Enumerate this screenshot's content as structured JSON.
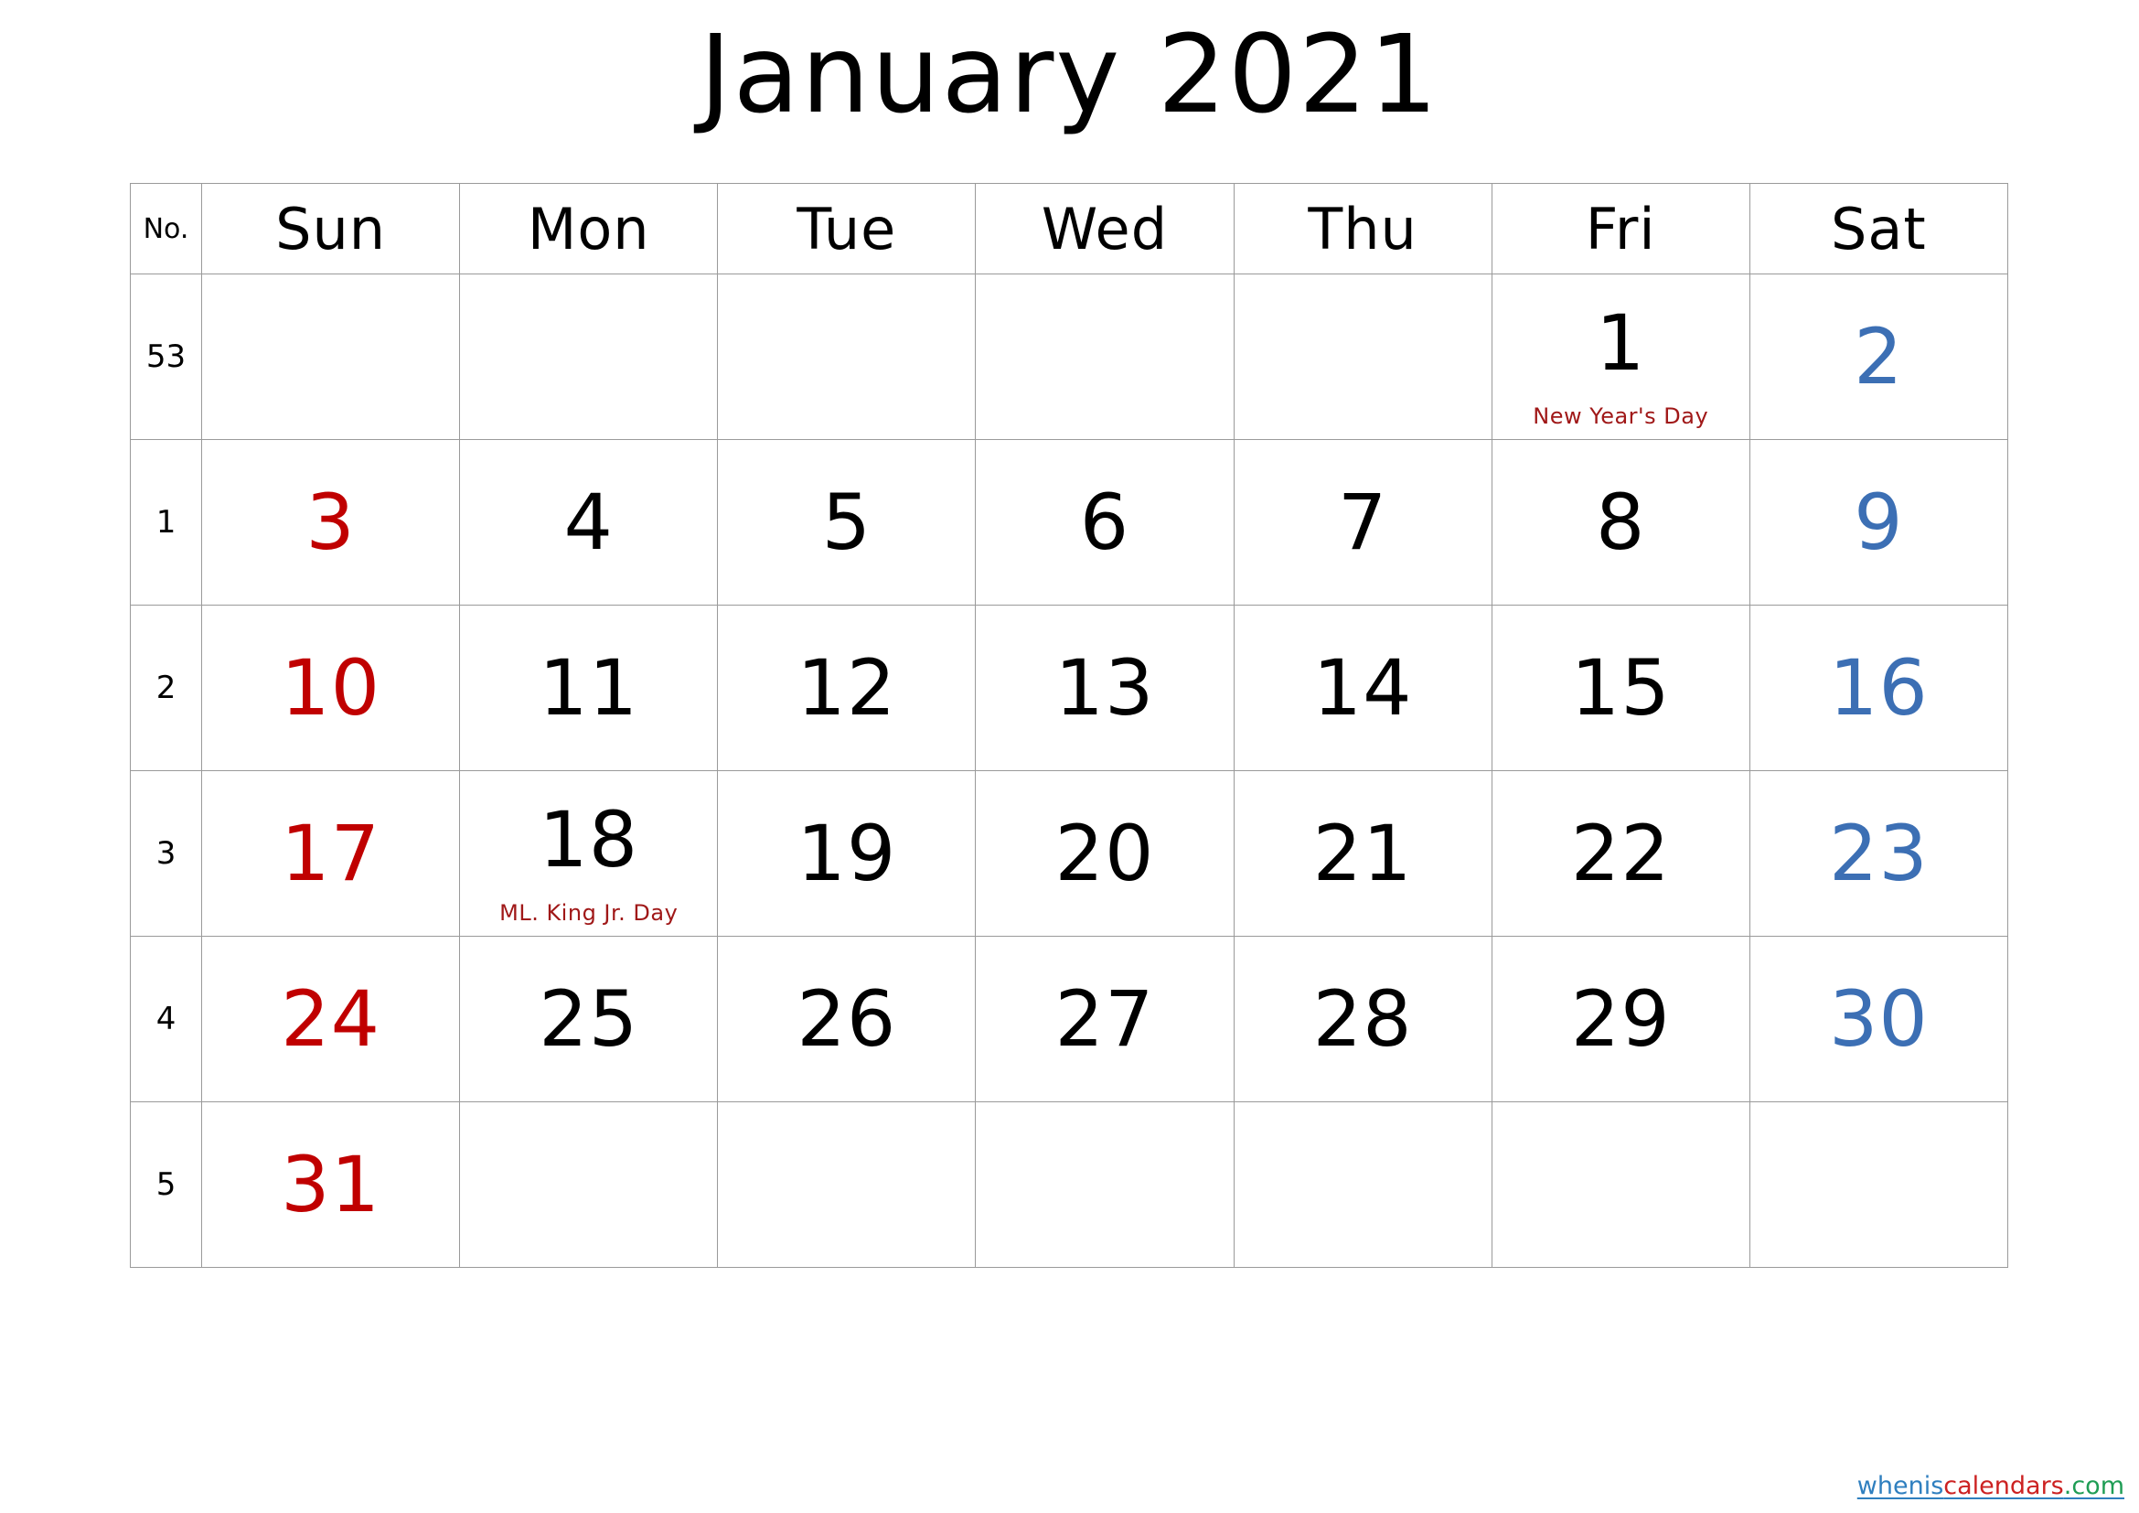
{
  "title": "January 2021",
  "colors": {
    "sunday": "#c00000",
    "saturday": "#3c6fb4",
    "weekday": "#000000",
    "holiday_note": "#a01818",
    "grid": "#9a9a9a",
    "watermark_blue": "#2f7fbf",
    "watermark_red": "#cc2222",
    "watermark_green": "#1f9d55"
  },
  "header": {
    "week_no_label": "No.",
    "days": [
      "Sun",
      "Mon",
      "Tue",
      "Wed",
      "Thu",
      "Fri",
      "Sat"
    ]
  },
  "weeks": [
    {
      "no": "53",
      "days": [
        {
          "date": "",
          "note": ""
        },
        {
          "date": "",
          "note": ""
        },
        {
          "date": "",
          "note": ""
        },
        {
          "date": "",
          "note": ""
        },
        {
          "date": "",
          "note": ""
        },
        {
          "date": "1",
          "note": "New Year's Day"
        },
        {
          "date": "2",
          "note": ""
        }
      ]
    },
    {
      "no": "1",
      "days": [
        {
          "date": "3",
          "note": ""
        },
        {
          "date": "4",
          "note": ""
        },
        {
          "date": "5",
          "note": ""
        },
        {
          "date": "6",
          "note": ""
        },
        {
          "date": "7",
          "note": ""
        },
        {
          "date": "8",
          "note": ""
        },
        {
          "date": "9",
          "note": ""
        }
      ]
    },
    {
      "no": "2",
      "days": [
        {
          "date": "10",
          "note": ""
        },
        {
          "date": "11",
          "note": ""
        },
        {
          "date": "12",
          "note": ""
        },
        {
          "date": "13",
          "note": ""
        },
        {
          "date": "14",
          "note": ""
        },
        {
          "date": "15",
          "note": ""
        },
        {
          "date": "16",
          "note": ""
        }
      ]
    },
    {
      "no": "3",
      "days": [
        {
          "date": "17",
          "note": ""
        },
        {
          "date": "18",
          "note": "ML. King Jr. Day"
        },
        {
          "date": "19",
          "note": ""
        },
        {
          "date": "20",
          "note": ""
        },
        {
          "date": "21",
          "note": ""
        },
        {
          "date": "22",
          "note": ""
        },
        {
          "date": "23",
          "note": ""
        }
      ]
    },
    {
      "no": "4",
      "days": [
        {
          "date": "24",
          "note": ""
        },
        {
          "date": "25",
          "note": ""
        },
        {
          "date": "26",
          "note": ""
        },
        {
          "date": "27",
          "note": ""
        },
        {
          "date": "28",
          "note": ""
        },
        {
          "date": "29",
          "note": ""
        },
        {
          "date": "30",
          "note": ""
        }
      ]
    },
    {
      "no": "5",
      "days": [
        {
          "date": "31",
          "note": ""
        },
        {
          "date": "",
          "note": ""
        },
        {
          "date": "",
          "note": ""
        },
        {
          "date": "",
          "note": ""
        },
        {
          "date": "",
          "note": ""
        },
        {
          "date": "",
          "note": ""
        },
        {
          "date": "",
          "note": ""
        }
      ]
    }
  ],
  "watermark": {
    "part1": "whenis",
    "part2": "calendars",
    "part3": ".com"
  }
}
